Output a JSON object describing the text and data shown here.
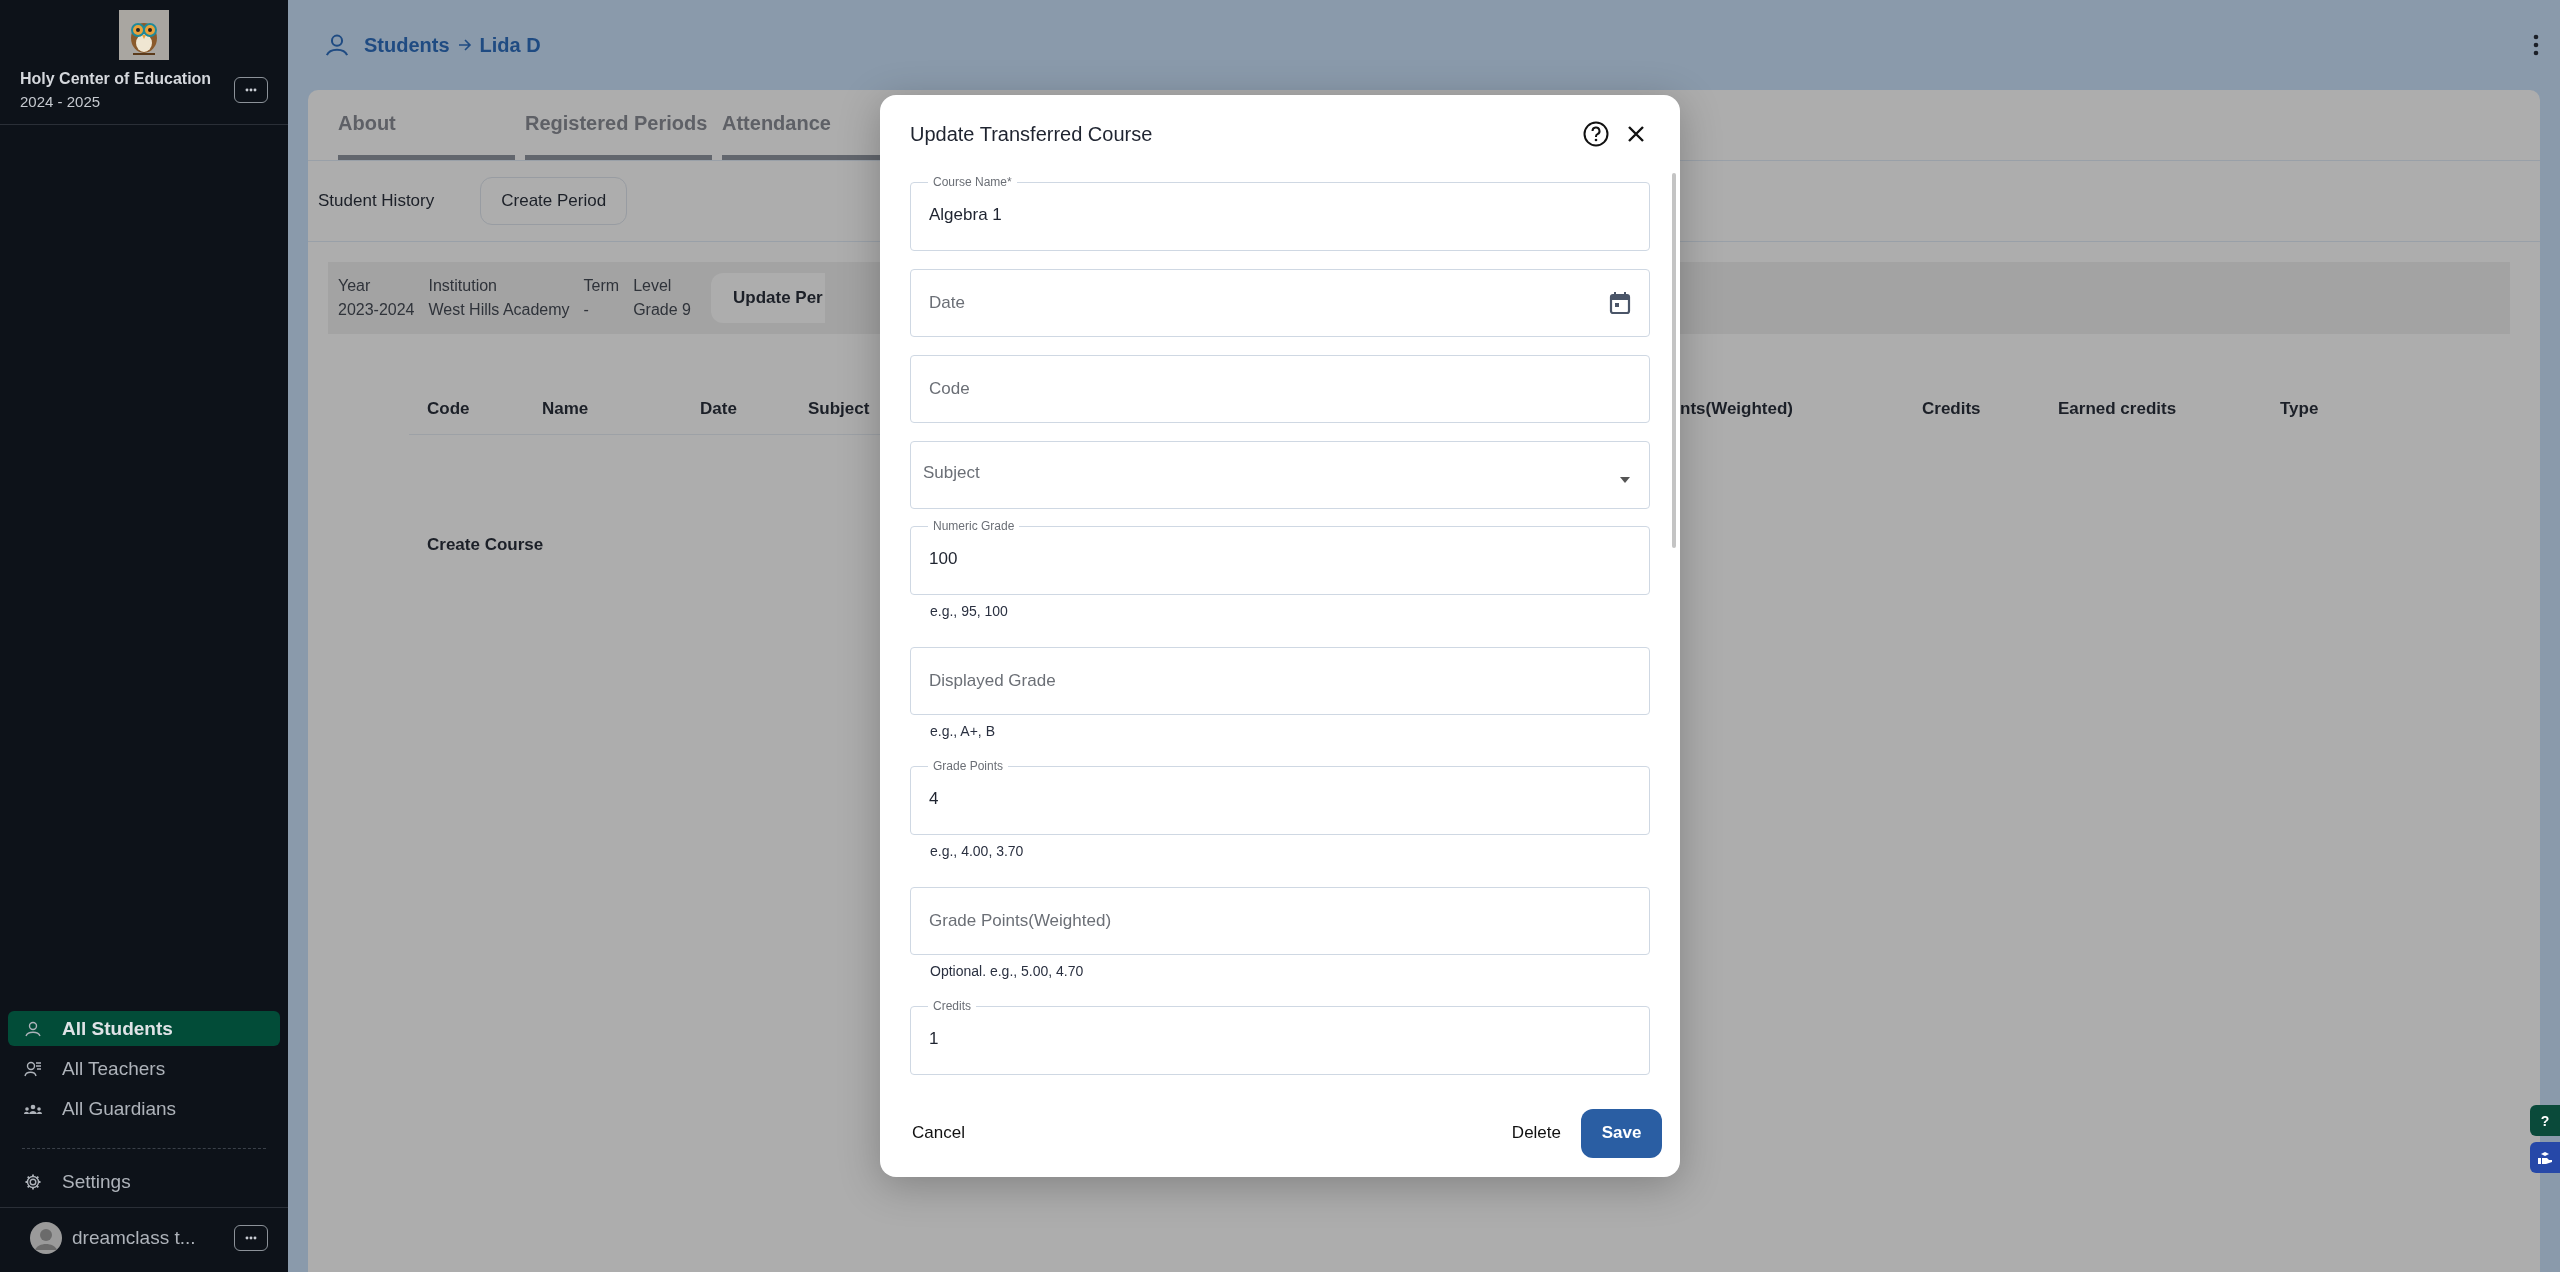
{
  "sidebar": {
    "school": {
      "name": "Holy Center of Education",
      "year": "2024 - 2025"
    },
    "nav": [
      {
        "label": "All Students",
        "selected": true
      },
      {
        "label": "All Teachers",
        "selected": false
      },
      {
        "label": "All Guardians",
        "selected": false
      }
    ],
    "settings": {
      "label": "Settings"
    },
    "user": {
      "name": "dreamclass t..."
    }
  },
  "header": {
    "breadcrumb": [
      "Students",
      "Lida D"
    ]
  },
  "tabs": [
    {
      "label": "About",
      "selected": false
    },
    {
      "label": "Registered Periods",
      "selected": false
    },
    {
      "label": "Attendance",
      "selected": false
    }
  ],
  "history": {
    "title": "Student History",
    "create_button": "Create Period"
  },
  "period": {
    "fields": [
      {
        "label": "Year",
        "value": "2023-2024"
      },
      {
        "label": "Institution",
        "value": "West Hills Academy"
      },
      {
        "label": "Term",
        "value": "-"
      },
      {
        "label": "Level",
        "value": "Grade 9"
      }
    ],
    "update_button": "Update Per"
  },
  "table": {
    "columns": [
      "Code",
      "Name",
      "Date",
      "Subject",
      "nts(Weighted)",
      "Credits",
      "Earned credits",
      "Type"
    ]
  },
  "create_course": "Create Course",
  "dialog": {
    "title": "Update Transferred Course",
    "fields": [
      {
        "kind": "text",
        "label": "Course Name*",
        "value": "Algebra 1"
      },
      {
        "kind": "date",
        "placeholder": "Date"
      },
      {
        "kind": "text",
        "placeholder": "Code"
      },
      {
        "kind": "select",
        "placeholder": "Subject"
      },
      {
        "kind": "text",
        "label": "Numeric Grade",
        "value": "100",
        "helper": "e.g., 95, 100"
      },
      {
        "kind": "text",
        "placeholder": "Displayed Grade",
        "helper": "e.g., A+, B"
      },
      {
        "kind": "text",
        "label": "Grade Points",
        "value": "4",
        "helper": "e.g., 4.00, 3.70"
      },
      {
        "kind": "text",
        "placeholder": "Grade Points(Weighted)",
        "helper": "Optional. e.g., 5.00, 4.70"
      },
      {
        "kind": "text",
        "label": "Credits",
        "value": "1"
      }
    ],
    "buttons": {
      "cancel": "Cancel",
      "delete": "Delete",
      "save": "Save"
    }
  },
  "floating_buttons": [
    {
      "kind": "help",
      "label": "?"
    },
    {
      "kind": "chat"
    }
  ]
}
